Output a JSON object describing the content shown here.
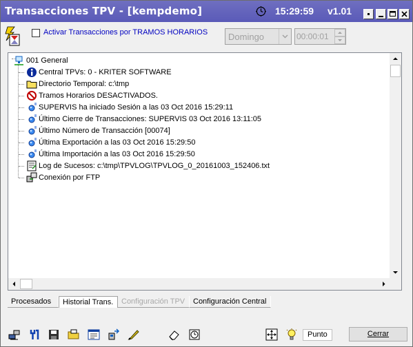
{
  "window": {
    "title": "Transacciones TPV - [kempdemo]",
    "time": "15:29:59",
    "version": "v1.01"
  },
  "options": {
    "checkbox_label": "Activar Transacciones por TRAMOS HORARIOS",
    "day_select": "Domingo",
    "time_value": "00:00:01"
  },
  "tree": {
    "root": "001 General",
    "items": [
      {
        "icon": "info-icon",
        "text": "Central TPVs: 0 - KRITER SOFTWARE"
      },
      {
        "icon": "folder-icon",
        "text": "Directorio Temporal: c:\\tmp"
      },
      {
        "icon": "prohibited-icon",
        "text": "Tramos Horarios DESACTIVADOS."
      },
      {
        "icon": "status-dot-icon",
        "text": "SUPERVIS ha iniciado Sesión a las 03 Oct 2016 15:29:11"
      },
      {
        "icon": "status-dot-icon",
        "text": "Último Cierre de Transacciones: SUPERVIS 03 Oct 2016 13:11:05"
      },
      {
        "icon": "status-dot-icon",
        "text": "Último Número de Transacción [00074]"
      },
      {
        "icon": "status-dot-icon",
        "text": "Última Exportación a las 03 Oct 2016 15:29:50"
      },
      {
        "icon": "status-dot-icon",
        "text": "Última Importación a las 03 Oct 2016 15:29:50"
      },
      {
        "icon": "log-file-icon",
        "text": "Log de Sucesos: c:\\tmp\\TPVLOG\\TPVLOG_0_20161003_152406.txt"
      },
      {
        "icon": "ftp-icon",
        "text": "Conexión por FTP"
      }
    ]
  },
  "tabs": [
    {
      "label": "Procesados",
      "state": "normal"
    },
    {
      "label": "Historial Trans.",
      "state": "active"
    },
    {
      "label": "Configuración TPV",
      "state": "disabled"
    },
    {
      "label": "Configuración Central",
      "state": "normal"
    }
  ],
  "footer": {
    "mode_value": "Punto",
    "close_label": "Cerrar"
  }
}
